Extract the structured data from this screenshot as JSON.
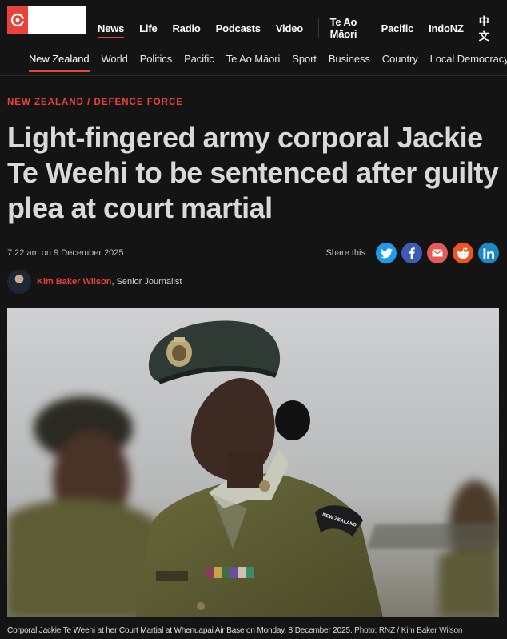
{
  "site": {
    "logo_alt": "RNZ"
  },
  "topnav": {
    "primary": [
      {
        "label": "News",
        "active": true
      },
      {
        "label": "Life"
      },
      {
        "label": "Radio"
      },
      {
        "label": "Podcasts"
      },
      {
        "label": "Video"
      }
    ],
    "secondary": [
      {
        "label": "Te Ao Māori"
      },
      {
        "label": "Pacific"
      },
      {
        "label": "IndoNZ"
      },
      {
        "label": "中文"
      }
    ]
  },
  "sections": [
    {
      "label": "New Zealand",
      "active": true
    },
    {
      "label": "World"
    },
    {
      "label": "Politics"
    },
    {
      "label": "Pacific"
    },
    {
      "label": "Te Ao Māori"
    },
    {
      "label": "Sport"
    },
    {
      "label": "Business"
    },
    {
      "label": "Country"
    },
    {
      "label": "Local Democracy Rep"
    }
  ],
  "article": {
    "kicker": "NEW ZEALAND / DEFENCE FORCE",
    "headline": "Light-fingered army corporal Jackie Te Weehi to be sentenced after guilty plea at court martial",
    "published": "7:22 am on 9 December 2025",
    "share_label": "Share this",
    "share_buttons": [
      {
        "icon": "twitter-icon",
        "color": "#1d9bf0"
      },
      {
        "icon": "facebook-icon",
        "color": "#3b5bb5"
      },
      {
        "icon": "email-icon",
        "color": "#e45a5a"
      },
      {
        "icon": "reddit-icon",
        "color": "#f1531f"
      },
      {
        "icon": "linkedin-icon",
        "color": "#1a8ac4"
      }
    ],
    "author": "Kim Baker Wilson",
    "author_role": ", Senior Journalist",
    "photo_caption": "Corporal Jackie Te Weehi at her Court Martial at Whenuapai Air Base on Monday, 8 December 2025.",
    "photo_credit": " Photo: RNZ / Kim Baker Wilson",
    "badge_text": "NEW ZEALAND"
  },
  "colors": {
    "accent": "#e8433a",
    "background": "#141414"
  }
}
